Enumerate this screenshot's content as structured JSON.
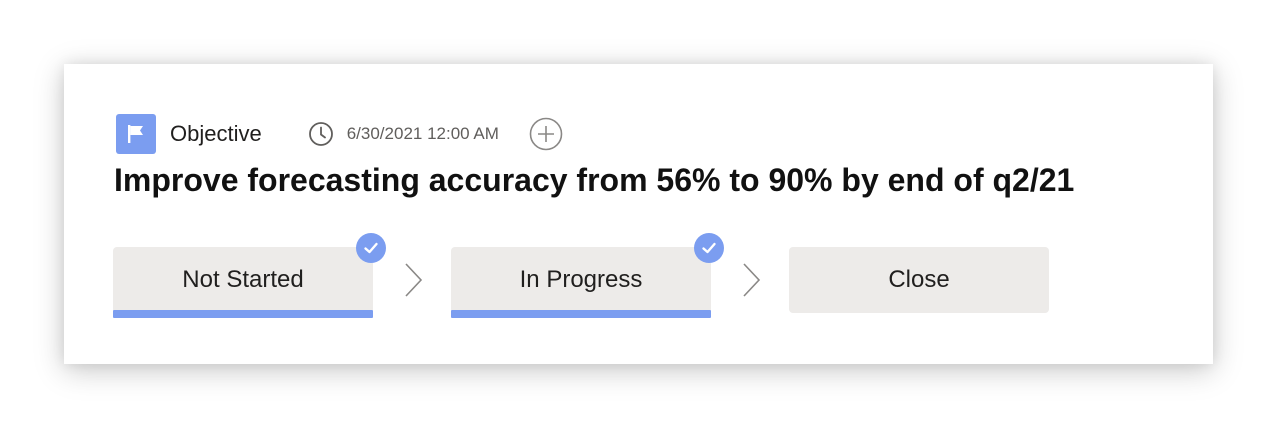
{
  "card": {
    "type_label": "Objective",
    "due_date": "6/30/2021 12:00 AM",
    "title": "Improve forecasting accuracy from 56% to 90% by end of q2/21"
  },
  "icons": {
    "type": "flag-icon",
    "date": "clock-icon",
    "add": "add-circle-icon",
    "separator": "chevron-right-icon",
    "completed": "checkmark-icon"
  },
  "stages": [
    {
      "label": "Not Started",
      "completed": true
    },
    {
      "label": "In Progress",
      "completed": true
    },
    {
      "label": "Close",
      "completed": false
    }
  ],
  "colors": {
    "accent": "#7b9df0",
    "stage_background": "#edebe9",
    "text": "#201f1e",
    "muted_text": "#605e5c"
  }
}
